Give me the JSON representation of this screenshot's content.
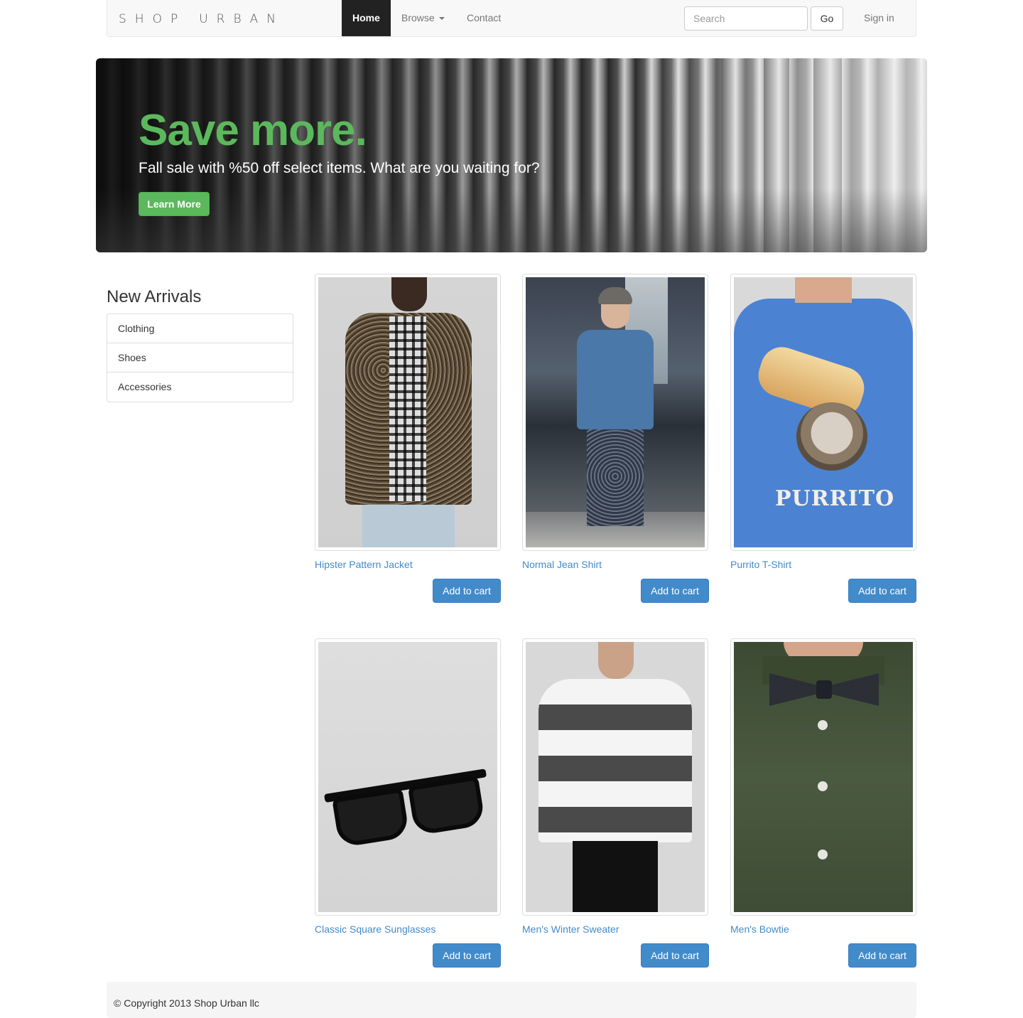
{
  "nav": {
    "brand_word1": "SHOP",
    "brand_word2": "URBAN",
    "items": [
      {
        "label": "Home",
        "active": true
      },
      {
        "label": "Browse"
      },
      {
        "label": "Contact"
      }
    ],
    "search_placeholder": "Search",
    "go_label": "Go",
    "signin_label": "Sign in"
  },
  "hero": {
    "title": "Save more.",
    "subtitle": "Fall sale with %50 off select items. What are you waiting for?",
    "button_label": "Learn More",
    "title_color": "#5cb85c"
  },
  "sidebar": {
    "title": "New Arrivals",
    "items": [
      "Clothing",
      "Shoes",
      "Accessories"
    ]
  },
  "products": [
    {
      "name": "Hipster Pattern Jacket",
      "button": "Add to cart"
    },
    {
      "name": "Normal Jean Shirt",
      "button": "Add to cart"
    },
    {
      "name": "Purrito T-Shirt",
      "button": "Add to cart",
      "print_text": "PURRITO"
    },
    {
      "name": "Classic Square Sunglasses",
      "button": "Add to cart"
    },
    {
      "name": "Men's Winter Sweater",
      "button": "Add to cart"
    },
    {
      "name": "Men's Bowtie",
      "button": "Add to cart"
    }
  ],
  "footer": {
    "copyright": "© Copyright 2013 Shop Urban llc"
  },
  "colors": {
    "link": "#428bca",
    "primary_button": "#428bca",
    "success": "#5cb85c",
    "nav_active_bg": "#222222"
  }
}
